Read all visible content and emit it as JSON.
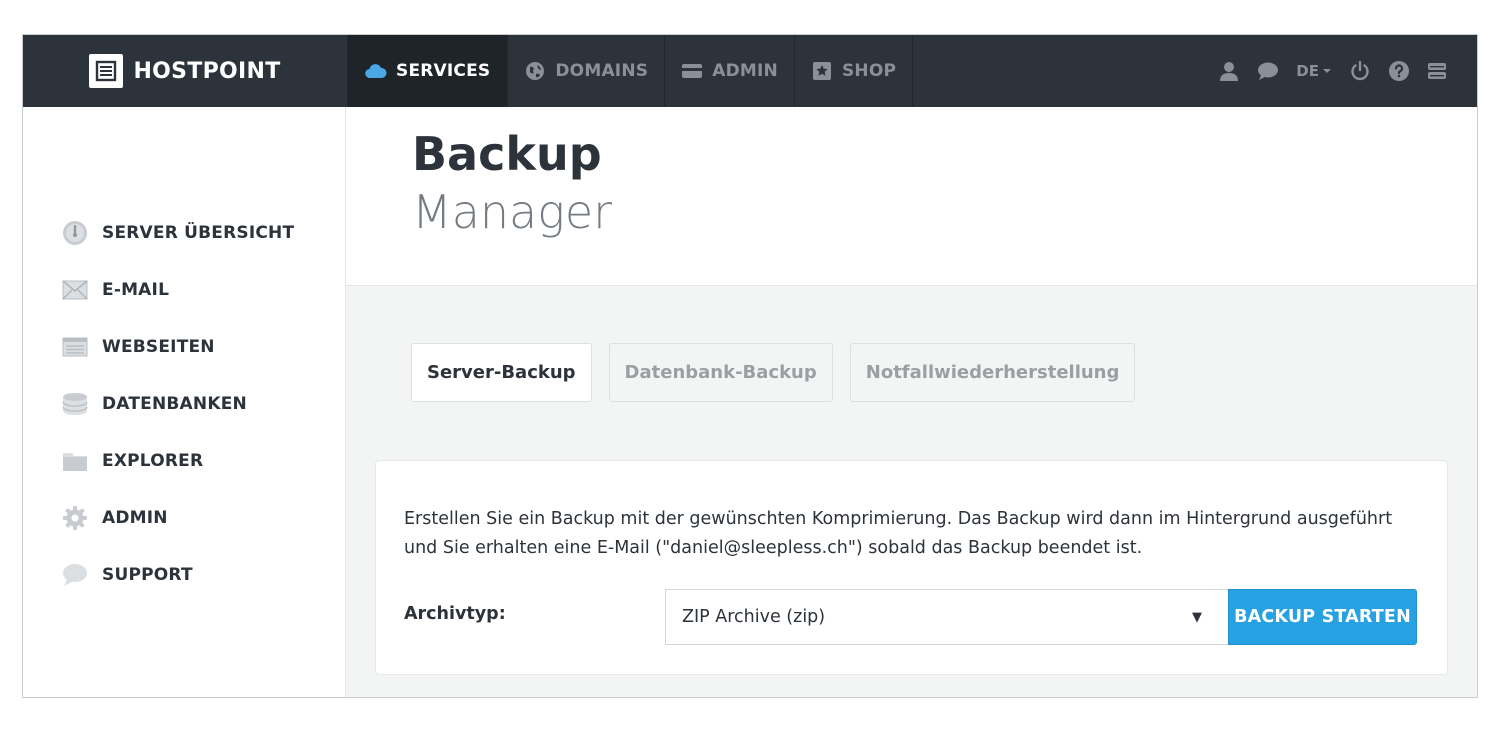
{
  "brand": {
    "name": "HOSTPOINT",
    "logo_icon": "book-icon"
  },
  "nav": {
    "items": [
      {
        "label": "SERVICES",
        "icon": "cloud-icon",
        "active": true
      },
      {
        "label": "DOMAINS",
        "icon": "globe-icon",
        "active": false
      },
      {
        "label": "ADMIN",
        "icon": "card-icon",
        "active": false
      },
      {
        "label": "SHOP",
        "icon": "star-icon",
        "active": false
      }
    ],
    "right": {
      "language": "DE"
    }
  },
  "sidebar": {
    "items": [
      {
        "label": "SERVER ÜBERSICHT",
        "icon": "gauge-icon"
      },
      {
        "label": "E-MAIL",
        "icon": "envelope-icon"
      },
      {
        "label": "WEBSEITEN",
        "icon": "browser-icon"
      },
      {
        "label": "DATENBANKEN",
        "icon": "database-icon"
      },
      {
        "label": "EXPLORER",
        "icon": "folder-icon"
      },
      {
        "label": "ADMIN",
        "icon": "gear-icon"
      },
      {
        "label": "SUPPORT",
        "icon": "chat-bubble-icon"
      }
    ]
  },
  "page": {
    "title_strong": "Backup",
    "title_light": "Manager"
  },
  "tabs": [
    {
      "label": "Server-Backup",
      "active": true
    },
    {
      "label": "Datenbank-Backup",
      "active": false
    },
    {
      "label": "Notfallwiederherstellung",
      "active": false
    }
  ],
  "backup_form": {
    "description": "Erstellen Sie ein Backup mit der gewünschten Komprimierung. Das Backup wird dann im Hintergrund ausgeführt und Sie erhalten eine E-Mail (\"daniel@sleepless.ch\") sobald das Backup beendet ist.",
    "archive_label": "Archivtyp:",
    "archive_value": "ZIP Archive (zip)",
    "caret": "▼",
    "start_button": "BACKUP STARTEN"
  },
  "colors": {
    "topbar": "#2d333b",
    "topbar_active": "#1f2429",
    "accent": "#27a1e2",
    "cloud": "#4aa8e6",
    "body_bg": "#f3f4f4"
  }
}
